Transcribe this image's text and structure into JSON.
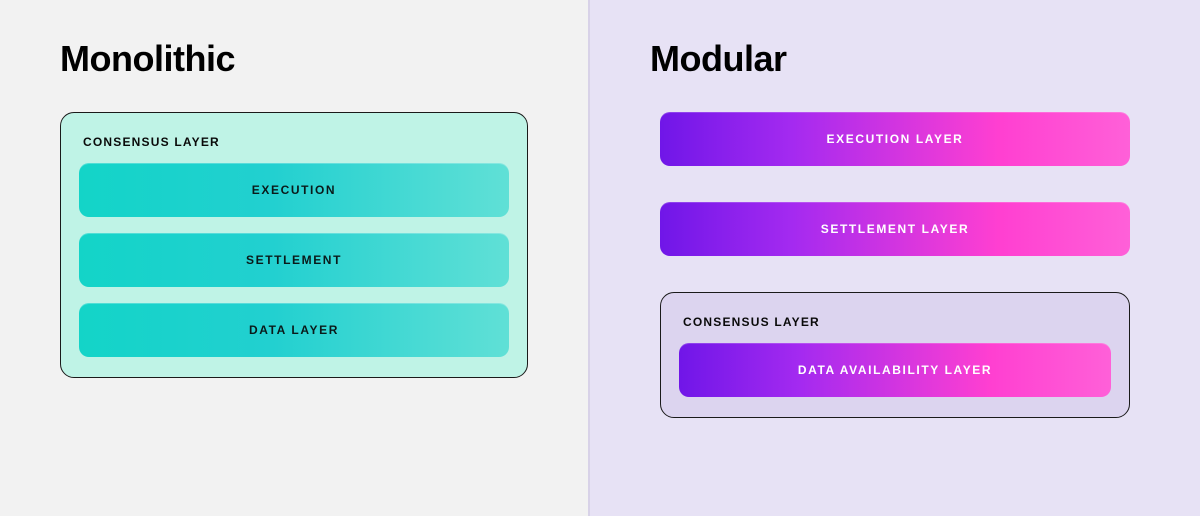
{
  "left": {
    "title": "Monolithic",
    "outer_label": "CONSENSUS LAYER",
    "bars": [
      "EXECUTION",
      "SETTLEMENT",
      "DATA LAYER"
    ]
  },
  "right": {
    "title": "Modular",
    "top_bars": [
      "EXECUTION  LAYER",
      "SETTLEMENT LAYER"
    ],
    "outer_label": "CONSENSUS LAYER",
    "inner_bar": "DATA AVAILABILITY LAYER"
  }
}
